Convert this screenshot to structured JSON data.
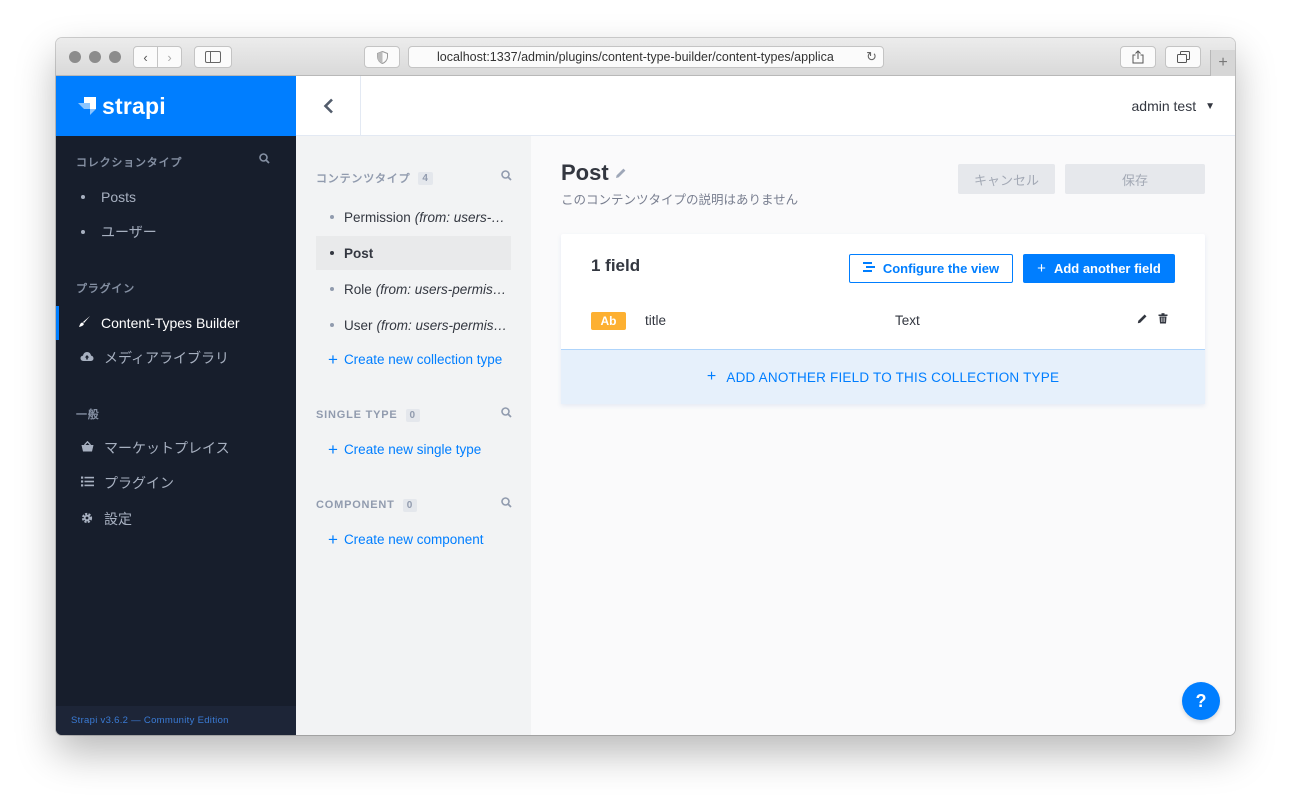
{
  "browser": {
    "url": "localhost:1337/admin/plugins/content-type-builder/content-types/applica"
  },
  "brand": {
    "name": "strapi"
  },
  "leftnav": {
    "collections_label": "コレクションタイプ",
    "collections": [
      "Posts",
      "ユーザー"
    ],
    "plugins_label": "プラグイン",
    "plugins": [
      {
        "label": "Content-Types Builder",
        "icon": "paintbrush-icon"
      },
      {
        "label": "メディアライブラリ",
        "icon": "cloud-upload-icon"
      }
    ],
    "general_label": "一般",
    "general": [
      {
        "label": "マーケットプレイス",
        "icon": "basket-icon"
      },
      {
        "label": "プラグイン",
        "icon": "list-icon"
      },
      {
        "label": "設定",
        "icon": "gear-icon"
      }
    ],
    "footer": "Strapi v3.6.2 — Community Edition"
  },
  "header": {
    "user": "admin test"
  },
  "subnav": {
    "content_types": {
      "label": "コンテンツタイプ",
      "count": "4",
      "items": [
        {
          "name": "Permission",
          "from": "(from: users-permissions)"
        },
        {
          "name": "Post",
          "from": ""
        },
        {
          "name": "Role",
          "from": "(from: users-permissions)"
        },
        {
          "name": "User",
          "from": "(from: users-permissions)"
        }
      ],
      "create_label": "Create new collection type"
    },
    "single_types": {
      "label": "SINGLE TYPE",
      "count": "0",
      "create_label": "Create new single type"
    },
    "components": {
      "label": "COMPONENT",
      "count": "0",
      "create_label": "Create new component"
    }
  },
  "main": {
    "title": "Post",
    "description": "このコンテンツタイプの説明はありません",
    "cancel_label": "キャンセル",
    "save_label": "保存",
    "field_count": "1 field",
    "configure_label": "Configure the view",
    "add_field_label": "Add another field",
    "fields": [
      {
        "badge": "Ab",
        "name": "title",
        "type": "Text"
      }
    ],
    "add_field_bar_label": "ADD ANOTHER FIELD TO THIS COLLECTION TYPE"
  },
  "help": {
    "label": "?"
  },
  "colors": {
    "brand": "#007eff",
    "nav_bg": "#171e2c",
    "badge_text": "#fdb031"
  }
}
